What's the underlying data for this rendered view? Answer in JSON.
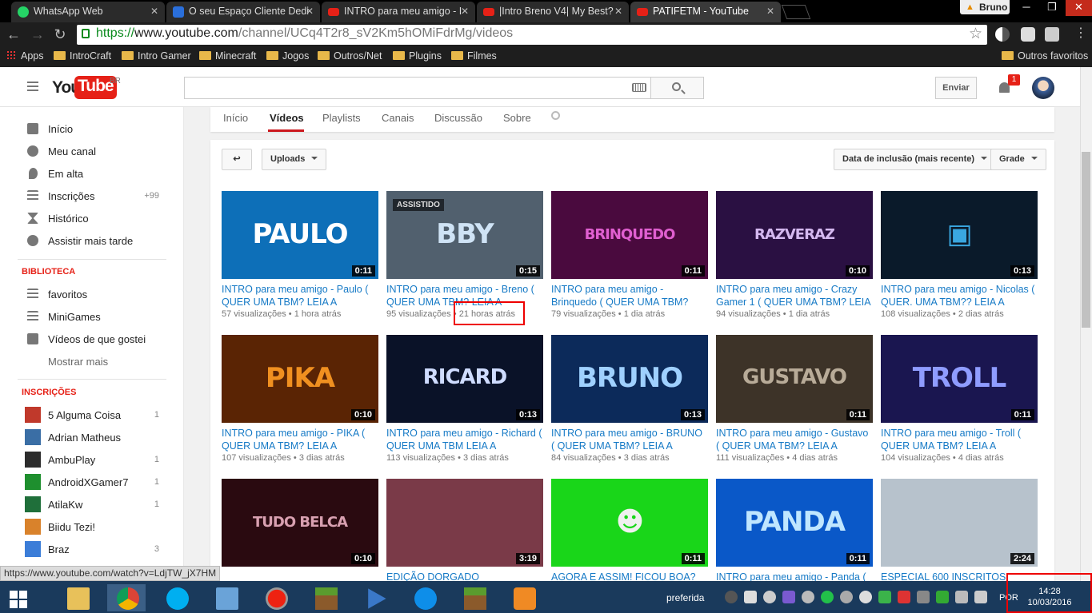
{
  "browser": {
    "tabs": [
      {
        "title": "WhatsApp Web",
        "icon": "whatsapp-icon"
      },
      {
        "title": "O seu Espaço Cliente Dedi",
        "icon": "site-icon"
      },
      {
        "title": "INTRO para meu amigo - I",
        "icon": "youtube-icon"
      },
      {
        "title": "|Intro Breno V4| My Best?",
        "icon": "youtube-icon"
      },
      {
        "title": "PATIFETM - YouTube",
        "icon": "youtube-icon"
      }
    ],
    "tab_close": "✕",
    "profile_name": "Bruno",
    "url_scheme": "https://",
    "url_host": "www.youtube.com",
    "url_path": "/channel/UCq4T2r8_sV2Km5hOMiFdrMg/videos",
    "bookmarks": [
      "Apps",
      "IntroCraft",
      "Intro Gamer",
      "Minecraft",
      "Jogos",
      "Outros/Net",
      "Plugins",
      "Filmes"
    ],
    "other_bookmarks": "Outros favoritos",
    "status_url": "https://www.youtube.com/watch?v=LdjTW_jX7HM"
  },
  "header": {
    "logo_you": "You",
    "logo_tube": "Tube",
    "country": "BR",
    "upload_label": "Enviar",
    "notification_count": "1"
  },
  "sidebar": {
    "main": [
      {
        "label": "Início",
        "icon": "home-icon"
      },
      {
        "label": "Meu canal",
        "icon": "account-icon"
      },
      {
        "label": "Em alta",
        "icon": "flame-icon"
      },
      {
        "label": "Inscrições",
        "icon": "subscriptions-icon",
        "count": "+99"
      },
      {
        "label": "Histórico",
        "icon": "hourglass-icon"
      },
      {
        "label": "Assistir mais tarde",
        "icon": "clock-icon"
      }
    ],
    "library_title": "BIBLIOTECA",
    "library": [
      {
        "label": "favoritos",
        "icon": "playlist-icon"
      },
      {
        "label": "MiniGames",
        "icon": "playlist-icon"
      },
      {
        "label": "Vídeos de que gostei",
        "icon": "thumbs-up-icon"
      }
    ],
    "show_more": "Mostrar mais",
    "subs_title": "INSCRIÇÕES",
    "subscriptions": [
      {
        "label": "5 Alguma Coisa",
        "count": "1",
        "color": "#c0392b"
      },
      {
        "label": "Adrian Matheus",
        "count": "",
        "color": "#3a6ea5"
      },
      {
        "label": "AmbuPlay",
        "count": "1",
        "color": "#2c2c2c"
      },
      {
        "label": "AndroidXGamer7",
        "count": "1",
        "color": "#1e8f2e"
      },
      {
        "label": "AtilaKw",
        "count": "1",
        "color": "#1f6f3a"
      },
      {
        "label": "Biidu Tezi!",
        "count": "",
        "color": "#d9822b"
      },
      {
        "label": "Braz",
        "count": "3",
        "color": "#3b7dd8"
      }
    ]
  },
  "channel_tabs": [
    {
      "label": "Início"
    },
    {
      "label": "Vídeos",
      "selected": true
    },
    {
      "label": "Playlists"
    },
    {
      "label": "Canais"
    },
    {
      "label": "Discussão"
    },
    {
      "label": "Sobre"
    }
  ],
  "controls": {
    "back": "↩",
    "uploads": "Uploads",
    "sort": "Data de inclusão (mais recente)",
    "view": "Grade"
  },
  "videos": [
    {
      "thumb": "PAULO",
      "title": "INTRO para meu amigo - Paulo ( QUER UMA TBM? LEIA A",
      "views": "57 visualizações",
      "age": "1 hora atrás",
      "duration": "0:11",
      "bg": "#0d6fb8",
      "fg": "#ffffff"
    },
    {
      "thumb": "BBY",
      "title": "INTRO para meu amigo - Breno ( QUER UMA TBM? LEIA A",
      "views": "95 visualizações",
      "age": "21 horas atrás",
      "duration": "0:15",
      "bg": "#51606e",
      "fg": "#cfe3f5",
      "watched": "ASSISTIDO"
    },
    {
      "thumb": "BRINQUEDO",
      "title": "INTRO para meu amigo - Brinquedo ( QUER UMA TBM?",
      "views": "79 visualizações",
      "age": "1 dia atrás",
      "duration": "0:11",
      "bg": "#4a0a3e",
      "fg": "#e05fd0"
    },
    {
      "thumb": "RAZVERAZ",
      "title": "INTRO para meu amigo - Crazy Gamer 1 ( QUER UMA TBM? LEIA A",
      "views": "94 visualizações",
      "age": "1 dia atrás",
      "duration": "0:10",
      "bg": "#2a1042",
      "fg": "#d4b8f0"
    },
    {
      "thumb": "▣",
      "title": "INTRO para meu amigo - Nicolas ( QUER. UMA TBM?? LEIA A",
      "views": "108 visualizações",
      "age": "2 dias atrás",
      "duration": "0:13",
      "bg": "#0a1a2a",
      "fg": "#3aa7e0"
    },
    {
      "thumb": "PIKA",
      "title": "INTRO para meu amigo - PIKA ( QUER UMA TBM? LEIA A",
      "views": "107 visualizações",
      "age": "3 dias atrás",
      "duration": "0:10",
      "bg": "#5a2404",
      "fg": "#f09020"
    },
    {
      "thumb": "RICARD",
      "title": "INTRO para meu amigo - Richard ( QUER UMA TBM LEIA A",
      "views": "113 visualizações",
      "age": "3 dias atrás",
      "duration": "0:13",
      "bg": "#0a1228",
      "fg": "#cfdcff"
    },
    {
      "thumb": "BRUNO",
      "title": "INTRO para meu amigo - BRUNO ( QUER UMA TBM? LEIA A",
      "views": "84 visualizações",
      "age": "3 dias atrás",
      "duration": "0:13",
      "bg": "#0c2a5a",
      "fg": "#9fd0ff"
    },
    {
      "thumb": "GUSTAVO",
      "title": "INTRO para meu amigo - Gustavo ( QUER UMA TBM? LEIA A",
      "views": "111 visualizações",
      "age": "4 dias atrás",
      "duration": "0:11",
      "bg": "#3d3328",
      "fg": "#b8ab98"
    },
    {
      "thumb": "TROLL",
      "title": "INTRO para meu amigo - Troll ( QUER UMA TBM? LEIA A",
      "views": "104 visualizações",
      "age": "4 dias atrás",
      "duration": "0:11",
      "bg": "#1a1650",
      "fg": "#8f9cff"
    },
    {
      "thumb": "TUDO BELCA",
      "title": "",
      "views": "",
      "age": "",
      "duration": "0:10",
      "bg": "#2a0a10",
      "fg": "#d8a0b0"
    },
    {
      "thumb": "",
      "title": "EDIÇÃO DORGADO",
      "views": "",
      "age": "",
      "duration": "3:19",
      "bg": "#7a3a48",
      "fg": "#ffffff"
    },
    {
      "thumb": "☻",
      "title": "AGORA E ASSIM! FICOU BOA?",
      "views": "",
      "age": "",
      "duration": "0:11",
      "bg": "#19d619",
      "fg": "#f0f0f0"
    },
    {
      "thumb": "PANDA",
      "title": "INTRO para meu amigo - Panda (",
      "views": "",
      "age": "",
      "duration": "0:11",
      "bg": "#0a58c8",
      "fg": "#bfe6ff"
    },
    {
      "thumb": "",
      "title": "ESPECIAL 600 INSCRITOS",
      "views": "",
      "age": "",
      "duration": "2:24",
      "bg": "#b7c2cc",
      "fg": "#333333"
    }
  ],
  "taskbar": {
    "keyboard_pref": "preferida",
    "language": "POR",
    "time": "14:28",
    "date": "10/03/2016"
  }
}
